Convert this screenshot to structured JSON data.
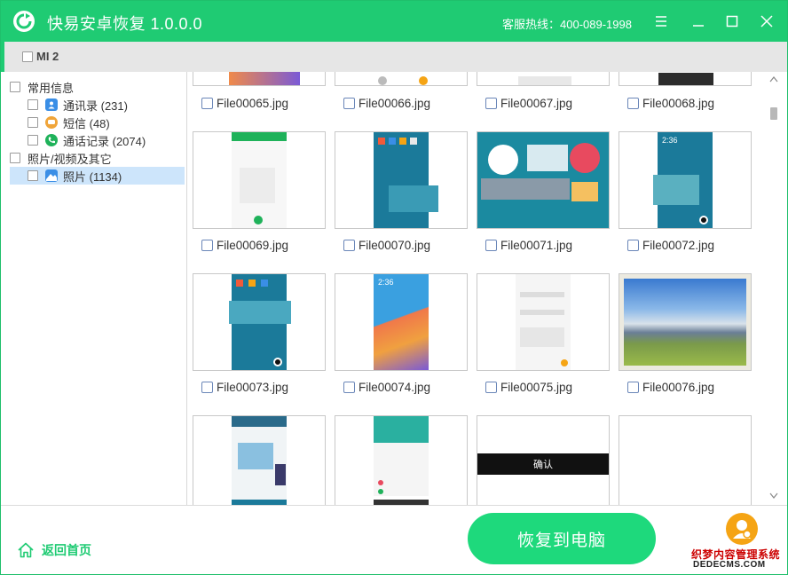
{
  "titlebar": {
    "app_title": "快易安卓恢复  1.0.0.0",
    "hotline": "客服热线：400-089-1998"
  },
  "device": {
    "name": "MI 2"
  },
  "sidebar": {
    "groups": [
      {
        "label": "常用信息",
        "items": [
          {
            "label": "通讯录 (231)",
            "icon": "contacts-icon",
            "color": "#3a8ee6"
          },
          {
            "label": "短信 (48)",
            "icon": "sms-icon",
            "color": "#f0a53a"
          },
          {
            "label": "通话记录 (2074)",
            "icon": "phone-icon",
            "color": "#1fb25a"
          }
        ]
      },
      {
        "label": "照片/视频及其它",
        "items": [
          {
            "label": "照片 (1134)",
            "icon": "photo-icon",
            "color": "#3a8ee6",
            "selected": true
          }
        ]
      }
    ]
  },
  "files": [
    "File00065.jpg",
    "File00066.jpg",
    "File00067.jpg",
    "File00068.jpg",
    "File00069.jpg",
    "File00070.jpg",
    "File00071.jpg",
    "File00072.jpg",
    "File00073.jpg",
    "File00074.jpg",
    "File00075.jpg",
    "File00076.jpg"
  ],
  "thumb_texts": {
    "confirm": "确认",
    "clock": "2:36"
  },
  "footer": {
    "home_label": "返回首页",
    "recover_label": "恢复到电脑",
    "watermark_line1": "织梦内容管理系统",
    "watermark_line2": "DEDECMS.COM"
  },
  "colors": {
    "accent": "#1fcb73",
    "button": "#1ed97c",
    "selected_row": "#cde5fb"
  }
}
